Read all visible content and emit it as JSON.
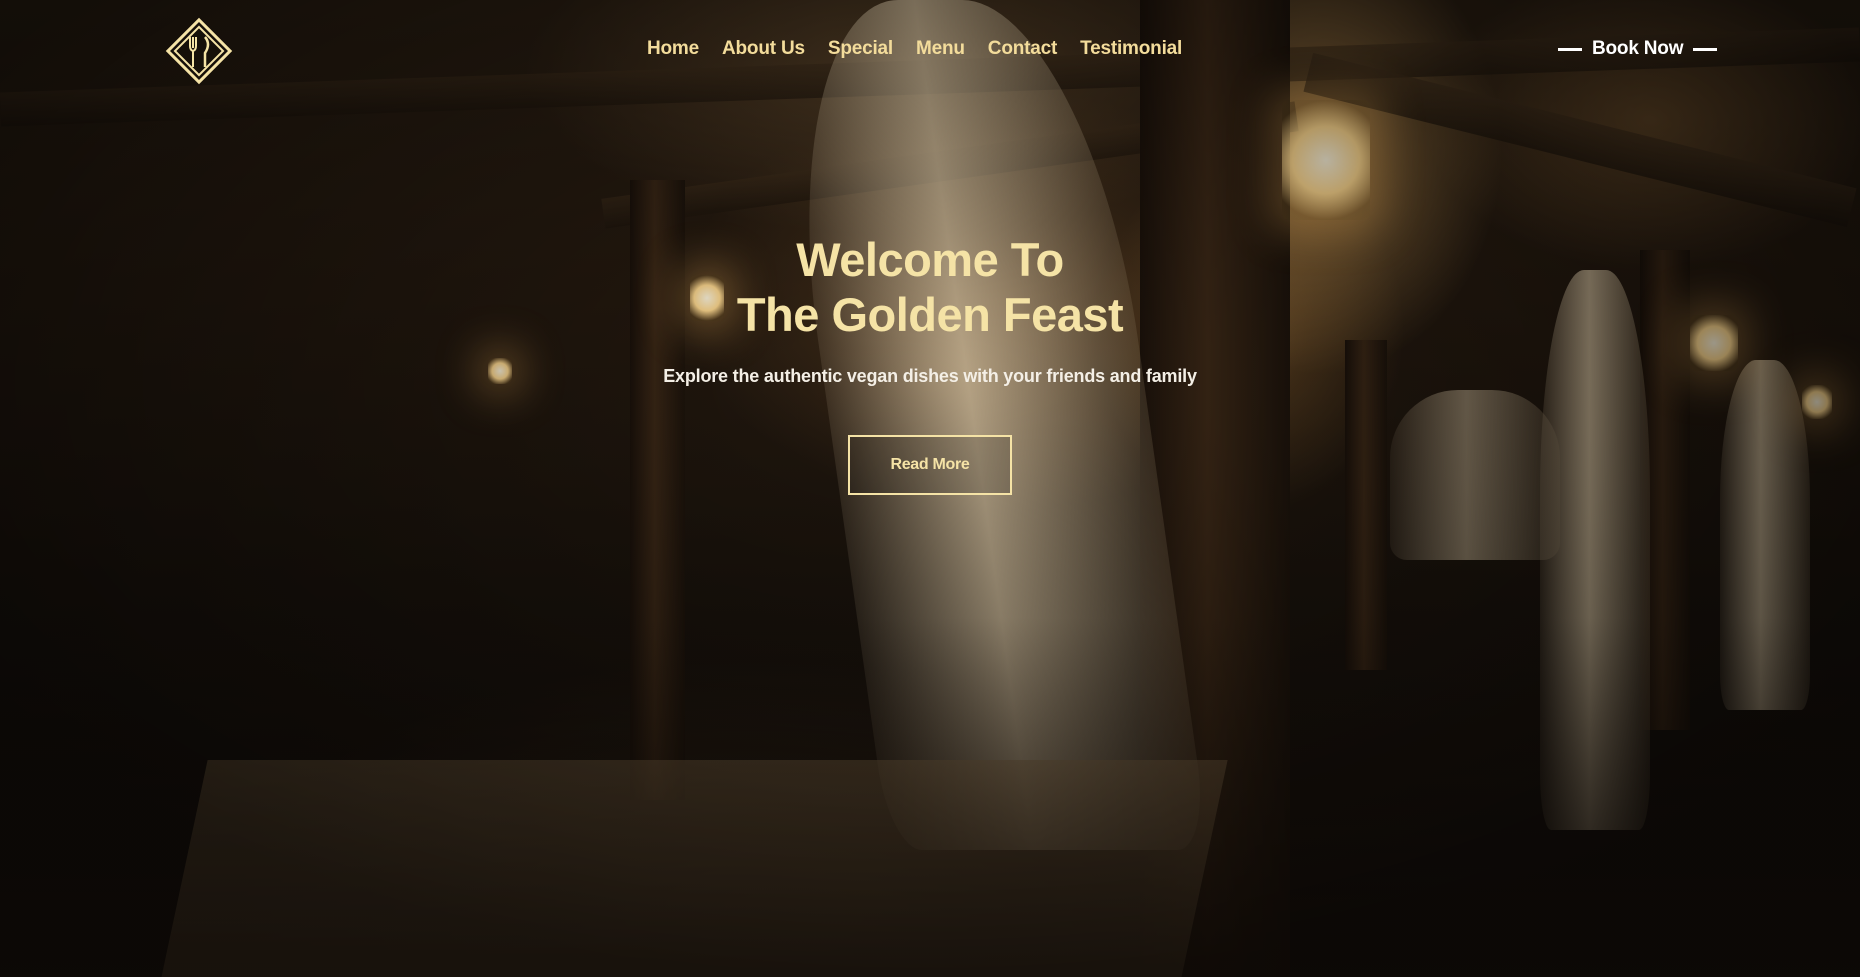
{
  "brand": {
    "logo_icon": "diamond-fork-knife-icon",
    "accent_color": "#f5e3a6"
  },
  "nav": {
    "items": [
      {
        "label": "Home"
      },
      {
        "label": "About Us"
      },
      {
        "label": "Special"
      },
      {
        "label": "Menu"
      },
      {
        "label": "Contact"
      },
      {
        "label": "Testimonial"
      }
    ],
    "book_label": "Book Now"
  },
  "hero": {
    "title_line1": "Welcome To",
    "title_line2": "The Golden Feast",
    "subtitle": "Explore the authentic vegan dishes with your friends and family",
    "cta_label": "Read More",
    "background": "dimly-lit-restaurant-interior"
  }
}
